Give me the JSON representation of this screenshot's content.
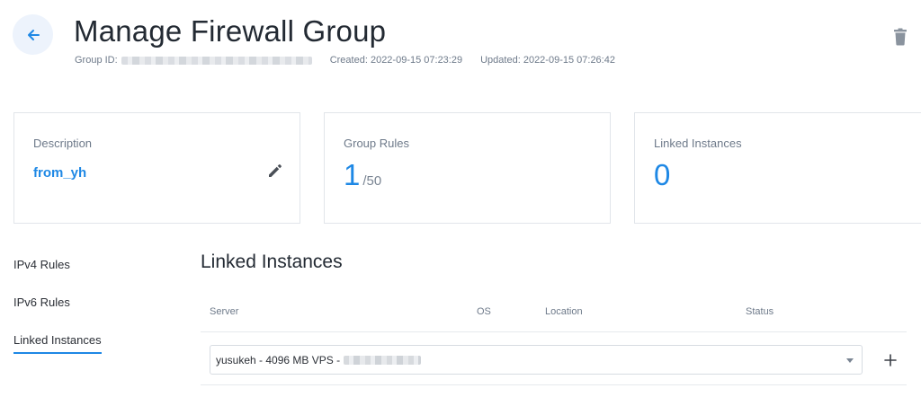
{
  "header": {
    "title": "Manage Firewall Group",
    "group_id_label": "Group ID:",
    "created_label": "Created:",
    "created_value": "2022-09-15 07:23:29",
    "updated_label": "Updated:",
    "updated_value": "2022-09-15 07:26:42"
  },
  "cards": {
    "description": {
      "label": "Description",
      "value": "from_yh"
    },
    "group_rules": {
      "label": "Group Rules",
      "count": "1",
      "max": "/50"
    },
    "linked_instances": {
      "label": "Linked Instances",
      "count": "0"
    }
  },
  "sidebar": {
    "items": [
      {
        "label": "IPv4 Rules",
        "active": false
      },
      {
        "label": "IPv6 Rules",
        "active": false
      },
      {
        "label": "Linked Instances",
        "active": true
      }
    ]
  },
  "main": {
    "section_title": "Linked Instances",
    "columns": [
      "Server",
      "OS",
      "Location",
      "Status"
    ],
    "instance_select": {
      "selected": "yusukeh - 4096 MB VPS -"
    }
  },
  "colors": {
    "accent": "#1e88e5",
    "muted_text": "#6e7a8a",
    "border": "#e1e5ea"
  },
  "icons": {
    "back": "arrow-left-icon",
    "delete": "trash-icon",
    "edit": "pencil-icon",
    "dropdown": "caret-down-icon",
    "add": "plus-icon"
  }
}
